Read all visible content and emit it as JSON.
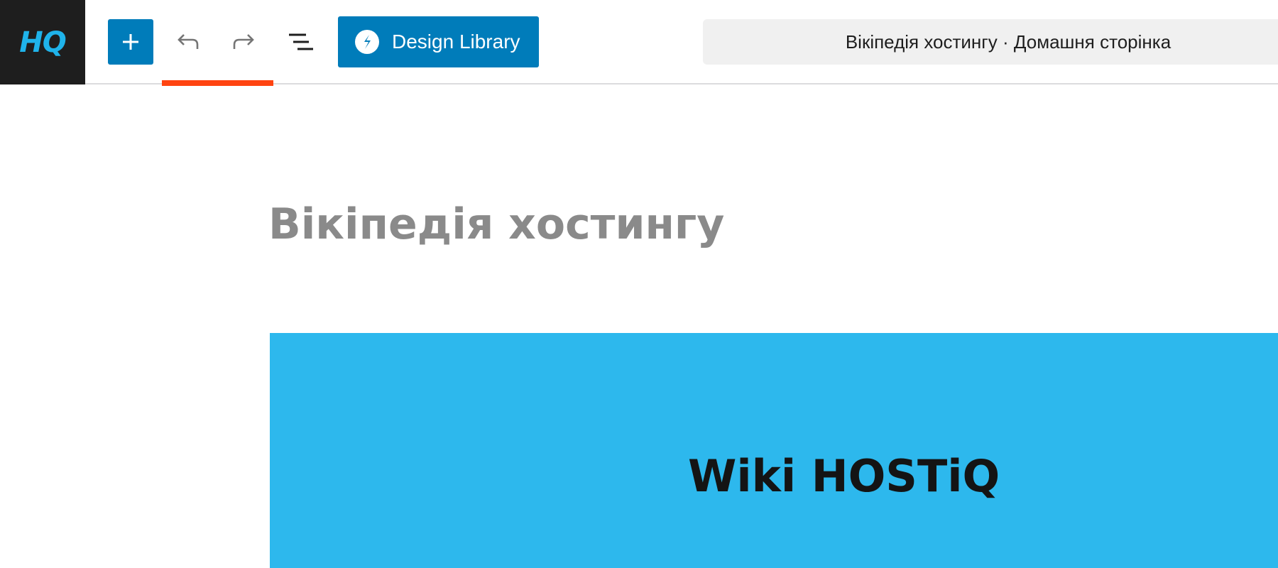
{
  "site": {
    "logo_text": "HQ",
    "logo_color": "#1fb3ea"
  },
  "toolbar": {
    "add_icon": "plus-icon",
    "undo_icon": "undo-icon",
    "redo_icon": "redo-icon",
    "list_view_icon": "list-view-icon",
    "design_library": {
      "label": "Design Library",
      "icon": "stackable-logo-icon"
    },
    "document_title": "Вікіпедія хостингу · Домашня сторінка",
    "accent_color": "#007cba",
    "indicator_color": "#ff4411"
  },
  "editor": {
    "page_title": "Вікіпедія хостингу",
    "hero": {
      "heading": "Wiki HOSTiQ",
      "background": "#2db8ed"
    }
  }
}
